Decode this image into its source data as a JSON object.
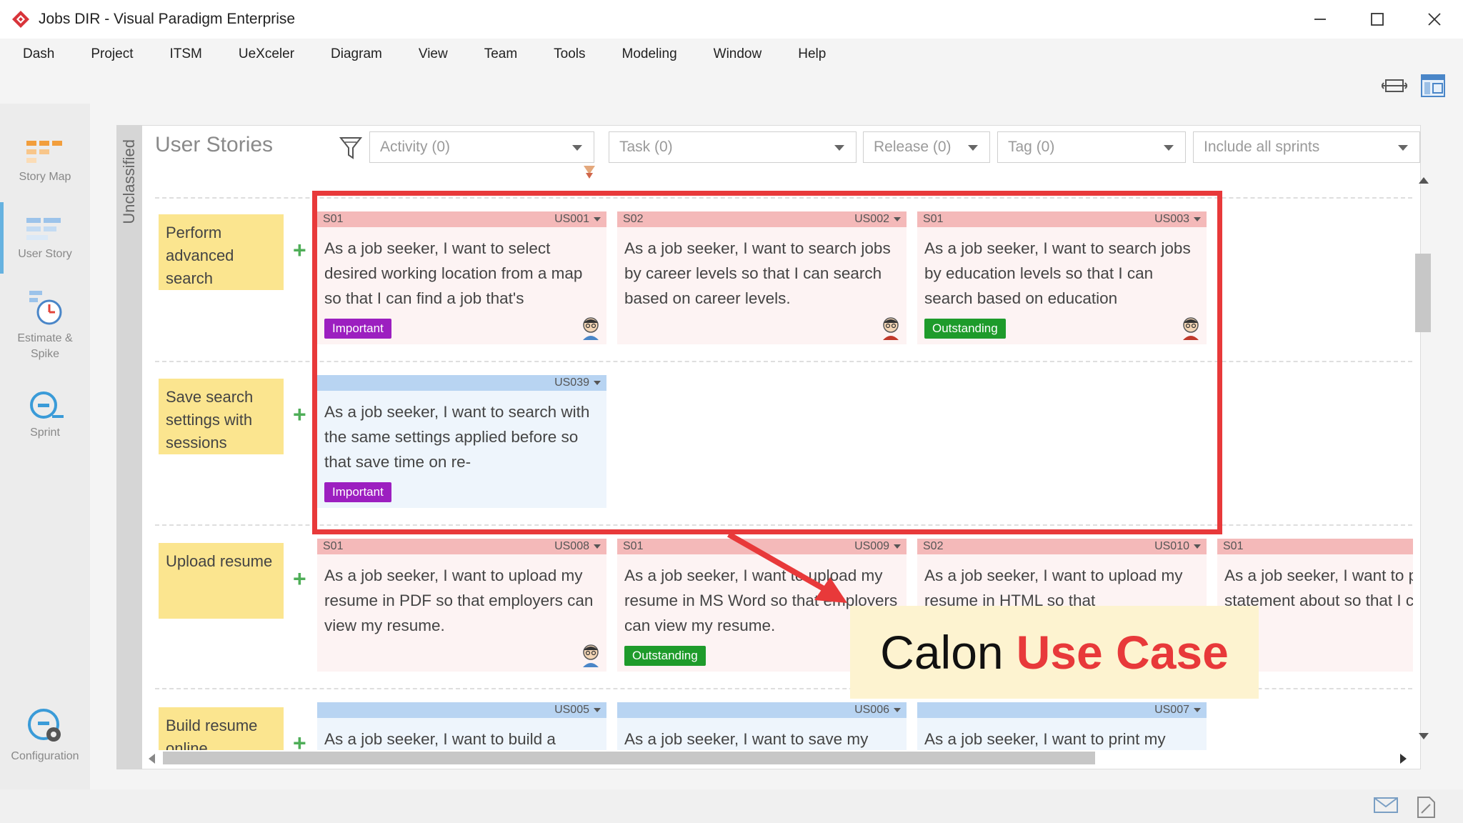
{
  "window": {
    "title": "Jobs DIR - Visual Paradigm Enterprise",
    "controls": [
      "minimize",
      "maximize",
      "close"
    ]
  },
  "menu": [
    "Dash",
    "Project",
    "ITSM",
    "UeXceler",
    "Diagram",
    "View",
    "Team",
    "Tools",
    "Modeling",
    "Window",
    "Help"
  ],
  "nav": {
    "story_map": "Story Map",
    "user_story": "User Story",
    "estimate_l1": "Estimate &",
    "estimate_l2": "Spike",
    "sprint": "Sprint",
    "configuration": "Configuration"
  },
  "panel": {
    "unclassified": "Unclassified",
    "title": "User Stories",
    "filters": {
      "activity": "Activity (0)",
      "task": "Task (0)",
      "release": "Release (0)",
      "tag": "Tag (0)",
      "sprints": "Include all sprints"
    }
  },
  "epics": [
    {
      "label": "Perform advanced search"
    },
    {
      "label": "Save search settings with sessions"
    },
    {
      "label": "Upload resume"
    },
    {
      "label": "Build resume online"
    }
  ],
  "cards": [
    {
      "sprint": "S01",
      "code": "US001",
      "text": "As a job seeker, I want to select desired working location from a map so that I can find a job that's",
      "tag": "Important"
    },
    {
      "sprint": "S02",
      "code": "US002",
      "text": "As a job seeker, I want to search jobs by career levels so that I can search based on career levels.",
      "tag": ""
    },
    {
      "sprint": "S01",
      "code": "US003",
      "text": "As a job seeker, I want to search jobs by education levels so that I can search based on education",
      "tag": "Outstanding"
    },
    {
      "sprint": "",
      "code": "US039",
      "text": "As a job seeker, I want to search with the same settings applied before so that save time on re-",
      "tag": "Important"
    },
    {
      "sprint": "S01",
      "code": "US008",
      "text": "As a job seeker, I want to upload my resume in PDF so that employers can view my resume.",
      "tag": ""
    },
    {
      "sprint": "S01",
      "code": "US009",
      "text": "As a job seeker, I want to upload my resume in MS Word so that employers can view my resume.",
      "tag": "Outstanding"
    },
    {
      "sprint": "S02",
      "code": "US010",
      "text": "As a job seeker, I want to upload my resume in HTML so that",
      "tag": ""
    },
    {
      "sprint": "S01",
      "code": "",
      "text": "As a job seeker, I want to privacy statement about so that I can decide",
      "tag": ""
    },
    {
      "sprint": "",
      "code": "US005",
      "text": "As a job seeker, I want to build a",
      "tag": ""
    },
    {
      "sprint": "",
      "code": "US006",
      "text": "As a job seeker, I want to save my",
      "tag": ""
    },
    {
      "sprint": "",
      "code": "US007",
      "text": "As a job seeker, I want to print my",
      "tag": ""
    }
  ],
  "callout": {
    "prefix": "Calon",
    "accent": "Use Case"
  },
  "colors": {
    "highlight": "#e8393a",
    "epic": "#fbe58f",
    "important": "#9c1fc0",
    "outstanding": "#1e9b2b"
  }
}
